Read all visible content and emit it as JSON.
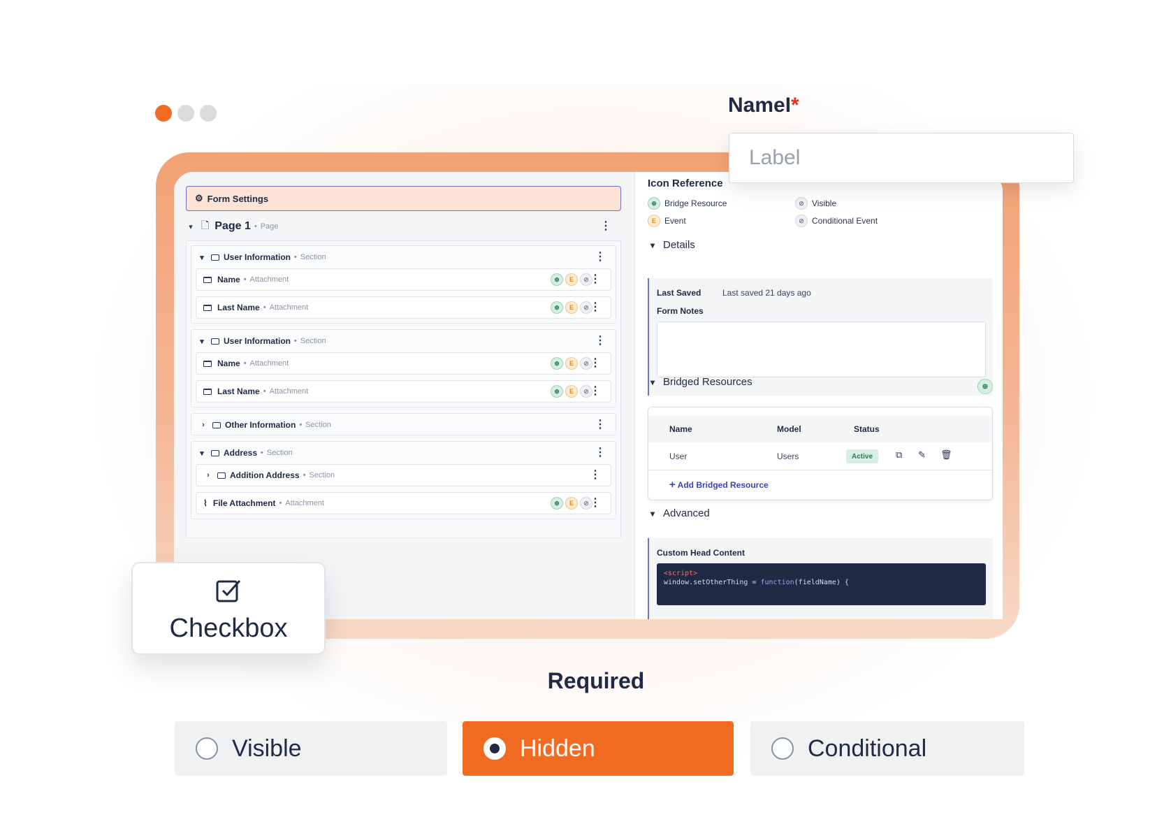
{
  "colors": {
    "accent": "#f26b22",
    "frame": "#f2a275",
    "indigo": "#6d6fd0",
    "dark": "#1f2a44"
  },
  "form_settings": {
    "label": "Form Settings",
    "icon": "gear-icon"
  },
  "page": {
    "title": "Page 1",
    "type": "Page"
  },
  "sections": [
    {
      "title": "User Information",
      "type": "Section",
      "fields": [
        {
          "name": "Name",
          "type": "Attachment"
        },
        {
          "name": "Last Name",
          "type": "Attachment"
        }
      ]
    },
    {
      "title": "User Information",
      "type": "Section",
      "fields": [
        {
          "name": "Name",
          "type": "Attachment"
        },
        {
          "name": "Last Name",
          "type": "Attachment"
        }
      ]
    },
    {
      "title": "Other Information",
      "type": "Section"
    },
    {
      "title": "Address",
      "type": "Section",
      "subsection": {
        "title": "Addition Address",
        "type": "Section"
      },
      "fields": [
        {
          "name": "File Attachment",
          "type": "Attachment"
        }
      ]
    }
  ],
  "badge_labels": {
    "event": "E"
  },
  "icon_reference": {
    "title": "Icon Reference",
    "items": [
      "Bridge Resource",
      "Visible",
      "Event",
      "Conditional Event"
    ]
  },
  "details": {
    "title": "Details",
    "last_saved_label": "Last Saved",
    "last_saved_value": "Last saved 21 days ago",
    "form_notes_label": "Form Notes"
  },
  "bridged_resources": {
    "title": "Bridged Resources",
    "columns": [
      "Name",
      "Model",
      "Status"
    ],
    "rows": [
      {
        "name": "User",
        "model": "Users",
        "status": "Active"
      }
    ],
    "add_label": "Add Bridged Resource"
  },
  "advanced": {
    "title": "Advanced",
    "custom_head_label": "Custom Head Content",
    "code_tag": "<script>",
    "code_line_start": "window.setOtherThing = ",
    "code_keyword": "function",
    "code_line_end": "(fieldName) {"
  },
  "name_field": {
    "label": "NameI",
    "required_mark": "*",
    "placeholder": "Label"
  },
  "checkbox_card": {
    "label": "Checkbox"
  },
  "required": {
    "title": "Required",
    "options": [
      {
        "label": "Visible",
        "selected": false
      },
      {
        "label": "Hidden",
        "selected": true
      },
      {
        "label": "Conditional",
        "selected": false
      }
    ]
  }
}
